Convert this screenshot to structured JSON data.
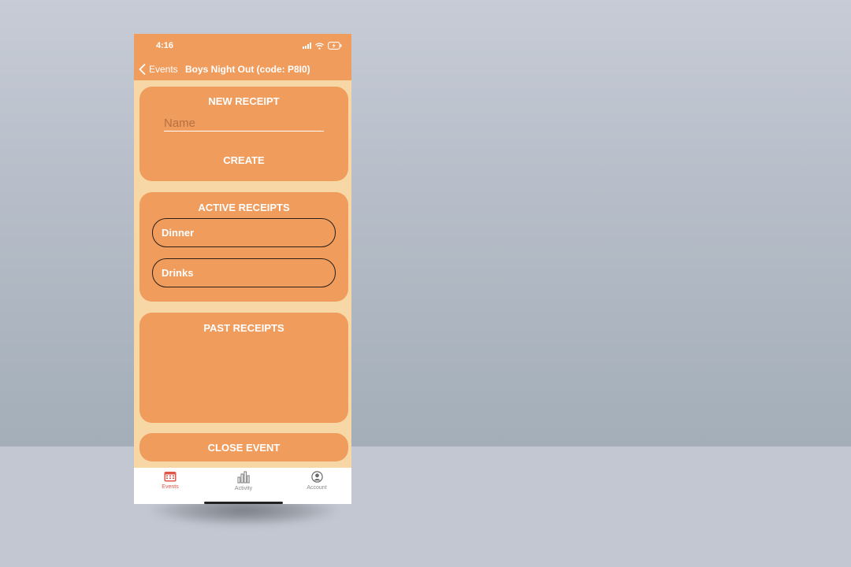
{
  "status_bar": {
    "time": "4:16"
  },
  "nav": {
    "back_label": "Events",
    "title": "Boys Night Out (code: P8I0)"
  },
  "new_receipt": {
    "title": "NEW RECEIPT",
    "name_placeholder": "Name",
    "name_value": "",
    "create_label": "CREATE"
  },
  "active_receipts": {
    "title": "ACTIVE RECEIPTS",
    "items": [
      {
        "label": "Dinner"
      },
      {
        "label": "Drinks"
      }
    ]
  },
  "past_receipts": {
    "title": "PAST RECEIPTS"
  },
  "close_event": {
    "label": "CLOSE EVENT"
  },
  "tabs": [
    {
      "label": "Events",
      "icon": "calendar-icon",
      "active": true
    },
    {
      "label": "Activity",
      "icon": "bar-chart-icon",
      "active": false
    },
    {
      "label": "Account",
      "icon": "user-circle-icon",
      "active": false
    }
  ],
  "colors": {
    "accent": "#ef9c5d",
    "background": "#f8d7a6",
    "tab_active": "#e2554a",
    "tab_inactive": "#8a8a8a"
  }
}
